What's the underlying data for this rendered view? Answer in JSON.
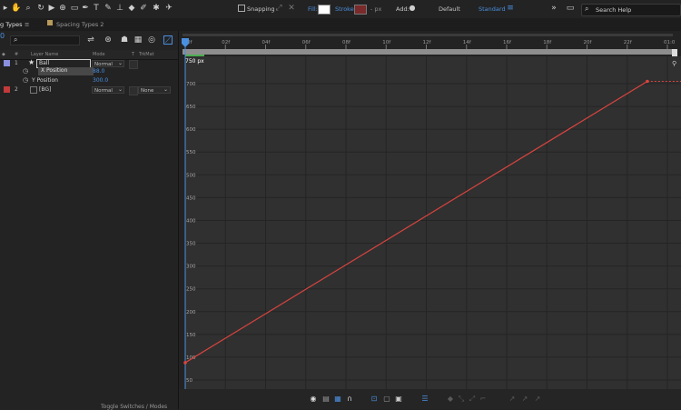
{
  "toolbar": {
    "snapping_label": "Snapping",
    "fill_label": "Fill:",
    "stroke_label": "Stroke:",
    "stroke_px": "- px",
    "add_label": "Add:",
    "workspace_default": "Default",
    "workspace_standard": "Standard",
    "search_placeholder": "Search Help"
  },
  "tabs": {
    "active": "g Types",
    "inactive": "Spacing Types 2"
  },
  "timecode_fragment": "0",
  "layers": {
    "headers": {
      "num": "#",
      "name": "Layer Name",
      "mode": "Mode",
      "t": "T",
      "trkmat": "TrkMat"
    },
    "items": [
      {
        "num": "1",
        "name": "Ball",
        "mode": "Normal",
        "color": "#8a8fe0"
      },
      {
        "num": "2",
        "name": "[BG]",
        "mode": "Normal",
        "trkmat": "None",
        "color": "#c23a3a"
      }
    ],
    "properties": [
      {
        "label": "X Position",
        "value": "88.0"
      },
      {
        "label": "Y Position",
        "value": "300.0"
      }
    ]
  },
  "timeline": {
    "ruler_ticks": [
      "0f",
      "02f",
      "04f",
      "06f",
      "08f",
      "10f",
      "12f",
      "14f",
      "16f",
      "18f",
      "20f",
      "22f",
      "01:0"
    ]
  },
  "graph": {
    "unit_label": "750 px",
    "y_ticks": [
      "700",
      "650",
      "600",
      "550",
      "500",
      "450",
      "400",
      "350",
      "300",
      "250",
      "200",
      "150",
      "100",
      "50"
    ],
    "curve_color": "#d9443f",
    "start_value": 88,
    "end_value": 705,
    "start_frame": 0,
    "end_frame": 23
  },
  "bottom": {
    "toggle_label": "Toggle Switches / Modes"
  }
}
